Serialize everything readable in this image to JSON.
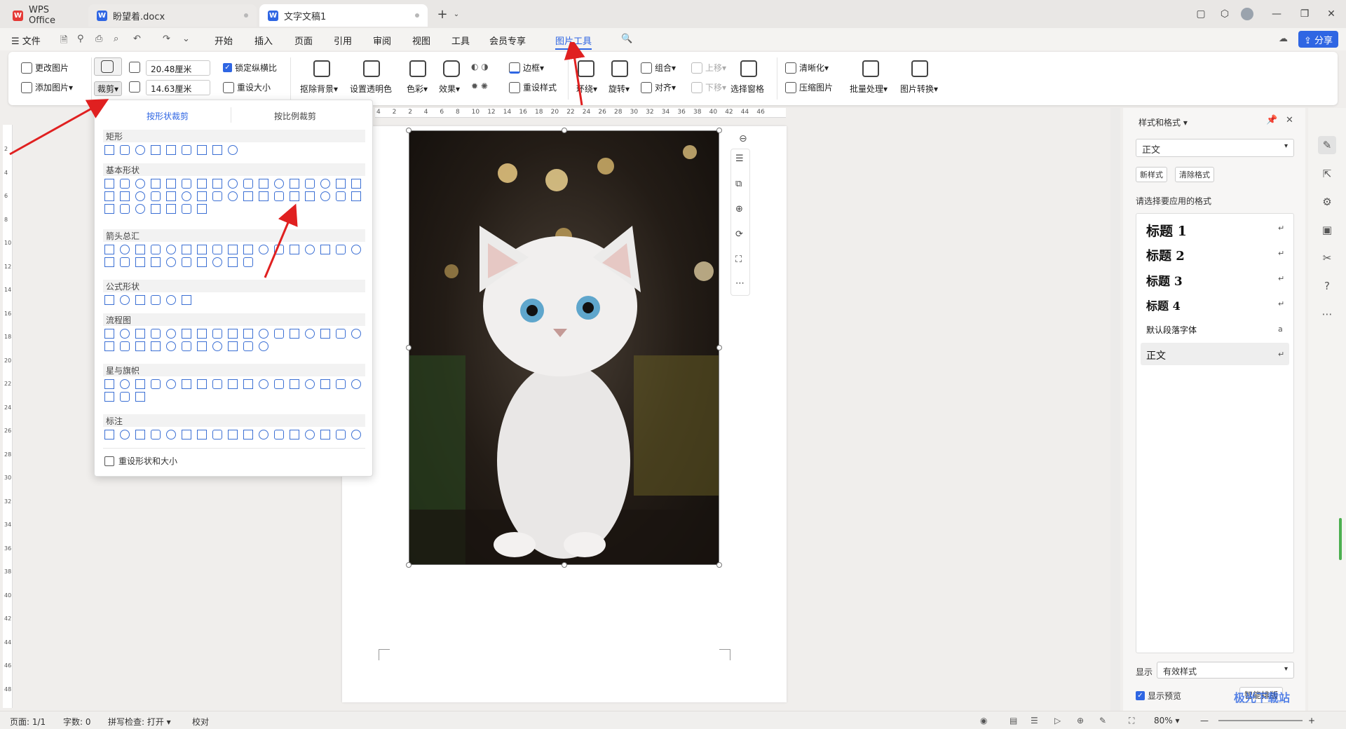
{
  "tabs": [
    {
      "label": "WPS Office",
      "icon": "wps-logo-icon",
      "color": "#e53935"
    },
    {
      "label": "盼望着.docx",
      "icon": "word-doc-icon",
      "color": "#2f66e3"
    },
    {
      "label": "文字文稿1",
      "icon": "word-doc-icon",
      "color": "#2f66e3"
    }
  ],
  "menu": {
    "file": "文件",
    "items": [
      "开始",
      "插入",
      "页面",
      "引用",
      "审阅",
      "视图",
      "工具",
      "会员专享",
      "图片工具"
    ],
    "share": "分享"
  },
  "ribbon": {
    "change_image": "更改图片",
    "add_image": "添加图片",
    "crop": "裁剪",
    "width_value": "20.48厘米",
    "height_value": "14.63厘米",
    "lock_ratio": "锁定纵横比",
    "reset_size": "重设大小",
    "remove_bg": "抠除背景",
    "set_transparent": "设置透明色",
    "color": "色彩",
    "effect": "效果",
    "border": "边框",
    "reset_style": "重设样式",
    "wrap": "环绕",
    "rotate": "旋转",
    "group": "组合",
    "align": "对齐",
    "move_up": "上移",
    "move_down": "下移",
    "selection_pane": "选择窗格",
    "sharpen": "清晰化",
    "compress": "压缩图片",
    "batch": "批量处理",
    "convert": "图片转换"
  },
  "crop_dropdown": {
    "tab_shape": "按形状裁剪",
    "tab_ratio": "按比例裁剪",
    "sections": [
      "矩形",
      "基本形状",
      "箭头总汇",
      "公式形状",
      "流程图",
      "星与旗帜",
      "标注"
    ],
    "reset": "重设形状和大小"
  },
  "ruler_ticks": [
    "4",
    "2",
    "2",
    "4",
    "6",
    "8",
    "10",
    "12",
    "14",
    "16",
    "18",
    "20",
    "22",
    "24",
    "26",
    "28",
    "30",
    "32",
    "34",
    "36",
    "38",
    "40",
    "42",
    "44",
    "46"
  ],
  "vruler_ticks": [
    "2",
    "4",
    "6",
    "8",
    "10",
    "12",
    "14",
    "16",
    "18",
    "20",
    "22",
    "24",
    "26",
    "28",
    "30",
    "32",
    "34",
    "36",
    "38",
    "40",
    "42",
    "44",
    "46",
    "48"
  ],
  "styles_panel": {
    "title": "样式和格式",
    "current": "正文",
    "new_style": "新样式",
    "clear_format": "清除格式",
    "prompt": "请选择要应用的格式",
    "items": [
      "标题 1",
      "标题 2",
      "标题 3",
      "标题 4",
      "默认段落字体",
      "正文"
    ],
    "show_label": "显示",
    "show_value": "有效样式",
    "preview": "显示预览",
    "smart": "智能排版"
  },
  "statusbar": {
    "page": "页面: 1/1",
    "words": "字数: 0",
    "spell": "拼写检查: 打开",
    "proof": "校对",
    "zoom": "80%"
  },
  "colors": {
    "accent": "#2f66e3",
    "shape_stroke": "#3b6fd4",
    "arrow": "#e02020"
  },
  "watermark": "极光下载站"
}
